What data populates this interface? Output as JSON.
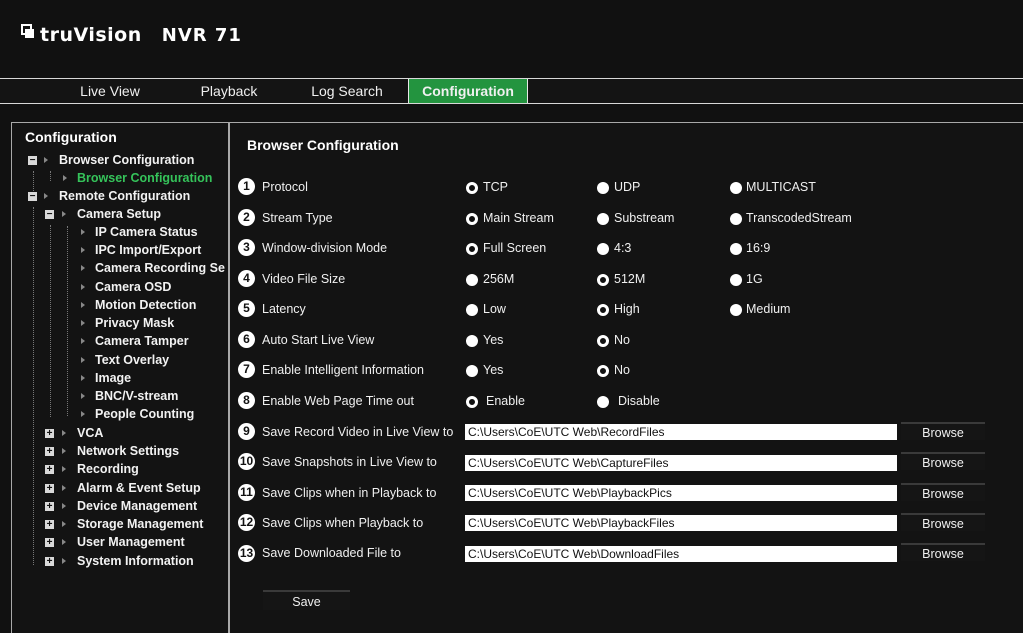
{
  "header": {
    "brand": "truVision",
    "model": "NVR 71"
  },
  "nav": {
    "tabs": [
      {
        "label": "Live View"
      },
      {
        "label": "Playback"
      },
      {
        "label": "Log Search"
      },
      {
        "label": "Configuration",
        "active": true
      }
    ]
  },
  "sidebar": {
    "title": "Configuration",
    "items": [
      {
        "label": "Browser Configuration"
      },
      {
        "label": "Browser Configuration",
        "selected": true
      },
      {
        "label": "Remote Configuration"
      },
      {
        "label": "Camera Setup"
      },
      {
        "label": "IP Camera Status"
      },
      {
        "label": "IPC Import/Export"
      },
      {
        "label": "Camera Recording Se"
      },
      {
        "label": "Camera OSD"
      },
      {
        "label": "Motion Detection"
      },
      {
        "label": "Privacy Mask"
      },
      {
        "label": "Camera Tamper"
      },
      {
        "label": "Text Overlay"
      },
      {
        "label": "Image"
      },
      {
        "label": "BNC/V-stream"
      },
      {
        "label": "People Counting"
      },
      {
        "label": "VCA"
      },
      {
        "label": "Network Settings"
      },
      {
        "label": "Recording"
      },
      {
        "label": "Alarm & Event Setup"
      },
      {
        "label": "Device Management"
      },
      {
        "label": "Storage Management"
      },
      {
        "label": "User Management"
      },
      {
        "label": "System Information"
      }
    ]
  },
  "main": {
    "title": "Browser Configuration",
    "radio_rows": [
      {
        "num": "1",
        "label": "Protocol",
        "options": [
          {
            "label": "TCP",
            "checked": true
          },
          {
            "label": "UDP"
          },
          {
            "label": "MULTICAST"
          }
        ]
      },
      {
        "num": "2",
        "label": "Stream Type",
        "options": [
          {
            "label": "Main Stream",
            "checked": true
          },
          {
            "label": "Substream"
          },
          {
            "label": "TranscodedStream"
          }
        ]
      },
      {
        "num": "3",
        "label": "Window-division Mode",
        "options": [
          {
            "label": "Full Screen",
            "checked": true
          },
          {
            "label": "4:3"
          },
          {
            "label": "16:9"
          }
        ]
      },
      {
        "num": "4",
        "label": "Video File Size",
        "options": [
          {
            "label": "256M"
          },
          {
            "label": "512M",
            "checked": true
          },
          {
            "label": "1G"
          }
        ]
      },
      {
        "num": "5",
        "label": "Latency",
        "options": [
          {
            "label": "Low"
          },
          {
            "label": "High",
            "checked": true
          },
          {
            "label": "Medium"
          }
        ]
      },
      {
        "num": "6",
        "label": "Auto Start Live View",
        "options": [
          {
            "label": "Yes"
          },
          {
            "label": "No",
            "checked": true
          }
        ]
      },
      {
        "num": "7",
        "label": "Enable Intelligent Information",
        "options": [
          {
            "label": "Yes"
          },
          {
            "label": "No",
            "checked": true
          }
        ]
      },
      {
        "num": "8",
        "label": "Enable Web Page Time out",
        "options": [
          {
            "label": "Enable",
            "checked": true
          },
          {
            "label": "Disable"
          }
        ]
      }
    ],
    "path_rows": [
      {
        "num": "9",
        "label": "Save Record Video in Live View to",
        "value": "C:\\Users\\CoE\\UTC Web\\RecordFiles",
        "button": "Browse"
      },
      {
        "num": "10",
        "label": "Save Snapshots in Live View to",
        "value": "C:\\Users\\CoE\\UTC Web\\CaptureFiles",
        "button": "Browse"
      },
      {
        "num": "11",
        "label": "Save Clips when in Playback to",
        "value": "C:\\Users\\CoE\\UTC Web\\PlaybackPics",
        "button": "Browse"
      },
      {
        "num": "12",
        "label": "Save Clips when Playback to",
        "value": "C:\\Users\\CoE\\UTC Web\\PlaybackFiles",
        "button": "Browse"
      },
      {
        "num": "13",
        "label": "Save Downloaded File to",
        "value": "C:\\Users\\CoE\\UTC Web\\DownloadFiles",
        "button": "Browse"
      }
    ],
    "save_label": "Save"
  }
}
